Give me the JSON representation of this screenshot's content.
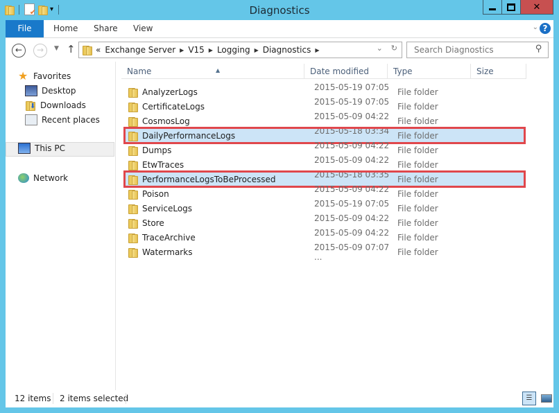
{
  "window": {
    "title": "Diagnostics",
    "quick_access": [
      "folder-icon",
      "properties-icon",
      "new-folder-icon",
      "customize-dropdown"
    ]
  },
  "ribbon": {
    "tabs": [
      {
        "label": "File",
        "active": true
      },
      {
        "label": "Home"
      },
      {
        "label": "Share"
      },
      {
        "label": "View"
      }
    ]
  },
  "address_bar": {
    "prefix": "«",
    "breadcrumbs": [
      "Exchange Server",
      "V15",
      "Logging",
      "Diagnostics"
    ]
  },
  "search": {
    "placeholder": "Search Diagnostics"
  },
  "nav_pane": {
    "favorites": "Favorites",
    "favorite_items": [
      "Desktop",
      "Downloads",
      "Recent places"
    ],
    "this_pc": "This PC",
    "network": "Network"
  },
  "columns": {
    "name": "Name",
    "date": "Date modified",
    "type": "Type",
    "size": "Size"
  },
  "files": [
    {
      "name": "AnalyzerLogs",
      "date": "2015-05-19 07:05 ...",
      "type": "File folder",
      "selected": false
    },
    {
      "name": "CertificateLogs",
      "date": "2015-05-19 07:05 ...",
      "type": "File folder",
      "selected": false
    },
    {
      "name": "CosmosLog",
      "date": "2015-05-09 04:22 ...",
      "type": "File folder",
      "selected": false
    },
    {
      "name": "DailyPerformanceLogs",
      "date": "2015-05-18 03:34 ...",
      "type": "File folder",
      "selected": true
    },
    {
      "name": "Dumps",
      "date": "2015-05-09 04:22 ...",
      "type": "File folder",
      "selected": false
    },
    {
      "name": "EtwTraces",
      "date": "2015-05-09 04:22 ...",
      "type": "File folder",
      "selected": false
    },
    {
      "name": "PerformanceLogsToBeProcessed",
      "date": "2015-05-18 03:35 ...",
      "type": "File folder",
      "selected": true
    },
    {
      "name": "Poison",
      "date": "2015-05-09 04:22 ...",
      "type": "File folder",
      "selected": false
    },
    {
      "name": "ServiceLogs",
      "date": "2015-05-19 07:05 ...",
      "type": "File folder",
      "selected": false
    },
    {
      "name": "Store",
      "date": "2015-05-09 04:22 ...",
      "type": "File folder",
      "selected": false
    },
    {
      "name": "TraceArchive",
      "date": "2015-05-09 04:22 ...",
      "type": "File folder",
      "selected": false
    },
    {
      "name": "Watermarks",
      "date": "2015-05-09 07:07 ...",
      "type": "File folder",
      "selected": false
    }
  ],
  "status": {
    "count": "12 items",
    "selected": "2 items selected"
  },
  "colors": {
    "title_bar": "#64c6e8",
    "file_tab": "#1979ca",
    "selection": "#cce4f7",
    "highlight_border": "#e0474c",
    "close_button": "#c75050"
  }
}
